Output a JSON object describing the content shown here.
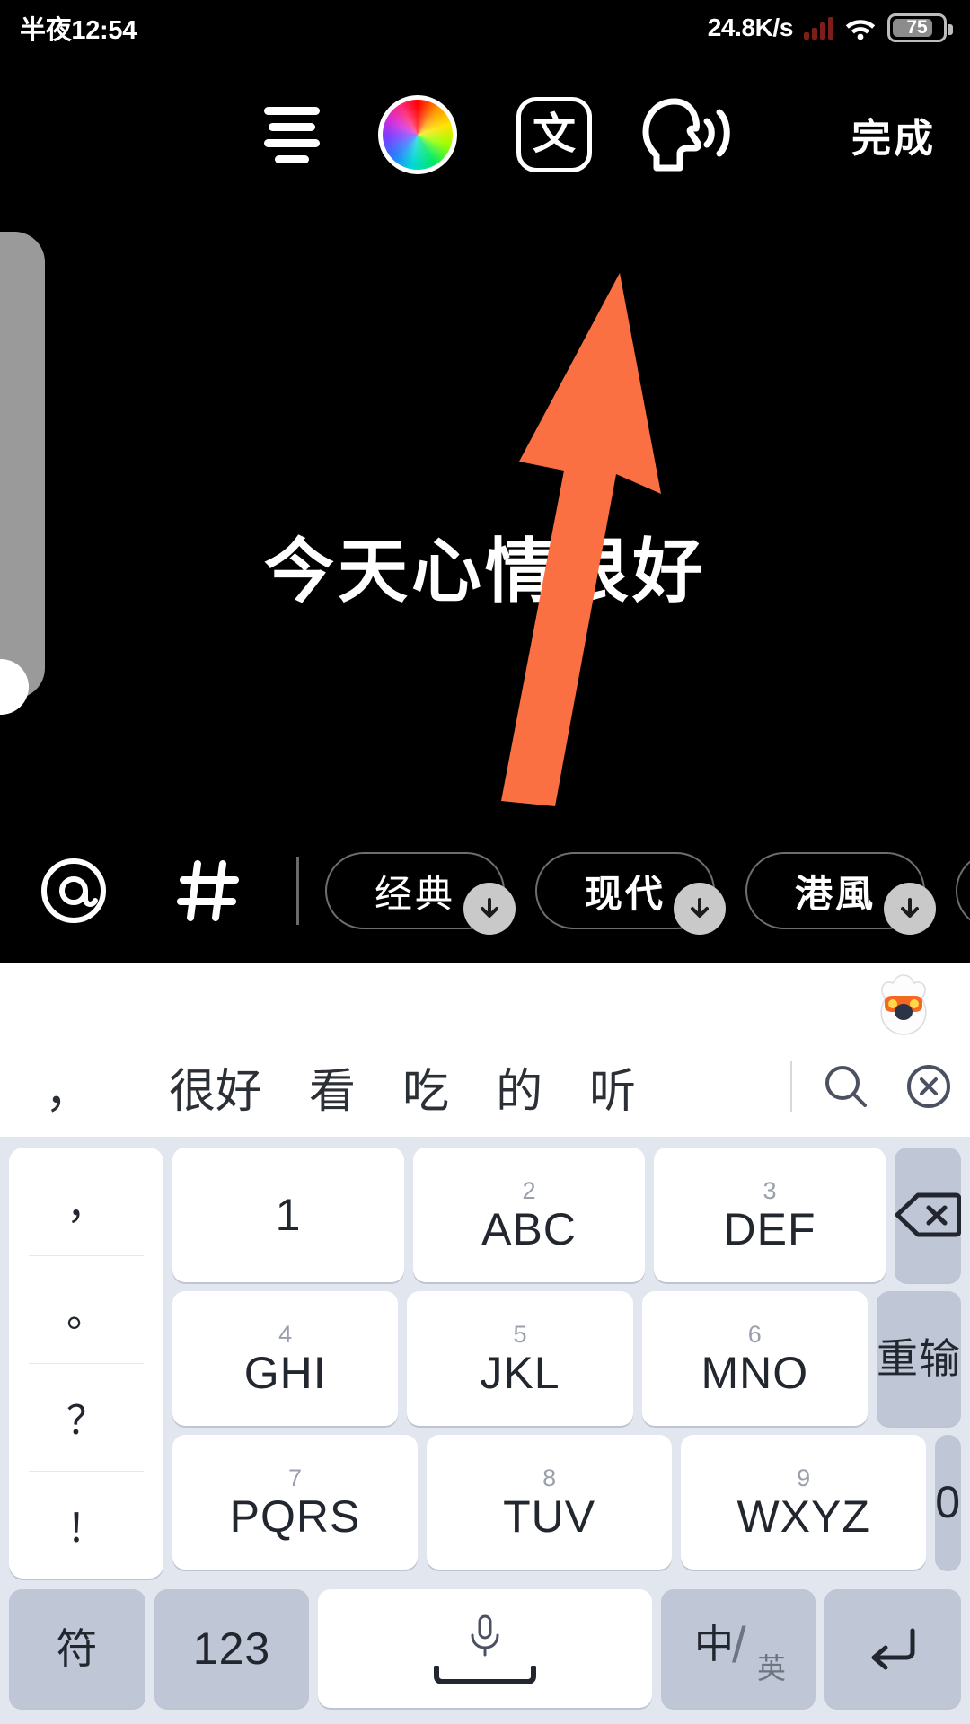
{
  "status_bar": {
    "time": "半夜12:54",
    "net_speed": "24.8K/s",
    "battery_level": "75",
    "signal_icon": "signal-bars-icon",
    "wifi_icon": "wifi-icon",
    "signal_color": "#7e1f17"
  },
  "top_toolbar": {
    "align_icon": "text-align-icon",
    "color_icon": "color-wheel-icon",
    "lang_label": "文",
    "tts_icon": "text-to-speech-head-icon",
    "done_label": "完成"
  },
  "canvas": {
    "overlay_text": "今天心情很好",
    "annotation": {
      "type": "arrow",
      "color": "#FB7042",
      "points_to": "text-to-speech-button"
    }
  },
  "editor_bottom": {
    "mention_icon": "at-icon",
    "hashtag_icon": "hash-icon",
    "style_chips": [
      {
        "label": "经典",
        "style": "classic",
        "download_icon": "download-arrow-icon"
      },
      {
        "label": "现代",
        "style": "modern",
        "download_icon": "download-arrow-icon"
      },
      {
        "label": "港風",
        "style": "gangfeng",
        "download_icon": "download-arrow-icon"
      },
      {
        "label": "",
        "style": "partial",
        "download_icon": ""
      }
    ]
  },
  "keyboard": {
    "mascot_icon": "fox-assistant-icon",
    "candidates": [
      "，",
      "很好",
      "看",
      "吃",
      "的",
      "听"
    ],
    "candidate_actions": [
      {
        "icon": "search-icon"
      },
      {
        "icon": "close-circle-icon"
      }
    ],
    "punctuation_column": [
      "，",
      "。",
      "？",
      "！"
    ],
    "rows": [
      [
        {
          "sup": "",
          "main": "1",
          "tone": "light",
          "name": "key-1"
        },
        {
          "sup": "2",
          "main": "ABC",
          "tone": "light",
          "name": "key-2-abc"
        },
        {
          "sup": "3",
          "main": "DEF",
          "tone": "light",
          "name": "key-3-def"
        },
        {
          "sup": "",
          "main": "",
          "tone": "dark",
          "name": "backspace-key",
          "icon": "backspace-icon"
        }
      ],
      [
        {
          "sup": "4",
          "main": "GHI",
          "tone": "light",
          "name": "key-4-ghi"
        },
        {
          "sup": "5",
          "main": "JKL",
          "tone": "light",
          "name": "key-5-jkl"
        },
        {
          "sup": "6",
          "main": "MNO",
          "tone": "light",
          "name": "key-6-mno"
        },
        {
          "sup": "",
          "main": "重输",
          "tone": "dark",
          "name": "reinput-key"
        }
      ],
      [
        {
          "sup": "7",
          "main": "PQRS",
          "tone": "light",
          "name": "key-7-pqrs"
        },
        {
          "sup": "8",
          "main": "TUV",
          "tone": "light",
          "name": "key-8-tuv"
        },
        {
          "sup": "9",
          "main": "WXYZ",
          "tone": "light",
          "name": "key-9-wxyz"
        },
        {
          "sup": "",
          "main": "0",
          "tone": "dark",
          "name": "key-0"
        }
      ]
    ],
    "bottom_row": {
      "symbols_label": "符",
      "numbers_label": "123",
      "space_icon": "microphone-icon",
      "lang_zh": "中",
      "lang_en": "英",
      "enter_icon": "enter-arrow-icon"
    }
  }
}
